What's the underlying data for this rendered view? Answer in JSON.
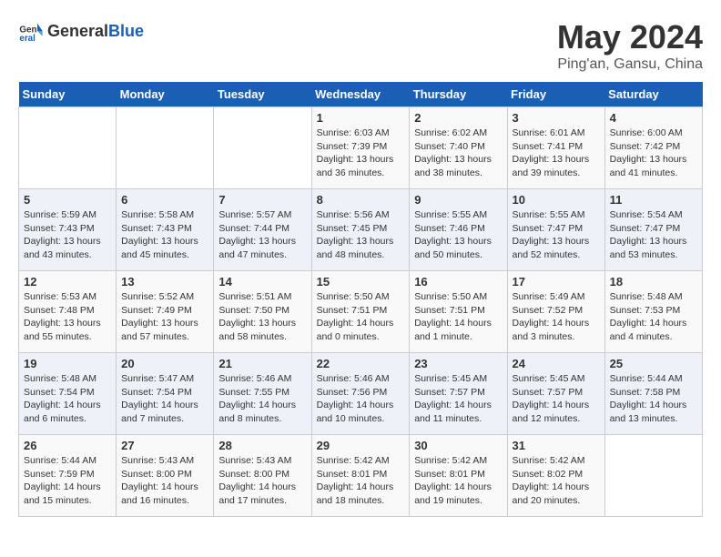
{
  "logo": {
    "text_general": "General",
    "text_blue": "Blue"
  },
  "title": "May 2024",
  "subtitle": "Ping'an, Gansu, China",
  "days_of_week": [
    "Sunday",
    "Monday",
    "Tuesday",
    "Wednesday",
    "Thursday",
    "Friday",
    "Saturday"
  ],
  "weeks": [
    [
      {
        "day": "",
        "info": ""
      },
      {
        "day": "",
        "info": ""
      },
      {
        "day": "",
        "info": ""
      },
      {
        "day": "1",
        "info": "Sunrise: 6:03 AM\nSunset: 7:39 PM\nDaylight: 13 hours\nand 36 minutes."
      },
      {
        "day": "2",
        "info": "Sunrise: 6:02 AM\nSunset: 7:40 PM\nDaylight: 13 hours\nand 38 minutes."
      },
      {
        "day": "3",
        "info": "Sunrise: 6:01 AM\nSunset: 7:41 PM\nDaylight: 13 hours\nand 39 minutes."
      },
      {
        "day": "4",
        "info": "Sunrise: 6:00 AM\nSunset: 7:42 PM\nDaylight: 13 hours\nand 41 minutes."
      }
    ],
    [
      {
        "day": "5",
        "info": "Sunrise: 5:59 AM\nSunset: 7:43 PM\nDaylight: 13 hours\nand 43 minutes."
      },
      {
        "day": "6",
        "info": "Sunrise: 5:58 AM\nSunset: 7:43 PM\nDaylight: 13 hours\nand 45 minutes."
      },
      {
        "day": "7",
        "info": "Sunrise: 5:57 AM\nSunset: 7:44 PM\nDaylight: 13 hours\nand 47 minutes."
      },
      {
        "day": "8",
        "info": "Sunrise: 5:56 AM\nSunset: 7:45 PM\nDaylight: 13 hours\nand 48 minutes."
      },
      {
        "day": "9",
        "info": "Sunrise: 5:55 AM\nSunset: 7:46 PM\nDaylight: 13 hours\nand 50 minutes."
      },
      {
        "day": "10",
        "info": "Sunrise: 5:55 AM\nSunset: 7:47 PM\nDaylight: 13 hours\nand 52 minutes."
      },
      {
        "day": "11",
        "info": "Sunrise: 5:54 AM\nSunset: 7:47 PM\nDaylight: 13 hours\nand 53 minutes."
      }
    ],
    [
      {
        "day": "12",
        "info": "Sunrise: 5:53 AM\nSunset: 7:48 PM\nDaylight: 13 hours\nand 55 minutes."
      },
      {
        "day": "13",
        "info": "Sunrise: 5:52 AM\nSunset: 7:49 PM\nDaylight: 13 hours\nand 57 minutes."
      },
      {
        "day": "14",
        "info": "Sunrise: 5:51 AM\nSunset: 7:50 PM\nDaylight: 13 hours\nand 58 minutes."
      },
      {
        "day": "15",
        "info": "Sunrise: 5:50 AM\nSunset: 7:51 PM\nDaylight: 14 hours\nand 0 minutes."
      },
      {
        "day": "16",
        "info": "Sunrise: 5:50 AM\nSunset: 7:51 PM\nDaylight: 14 hours\nand 1 minute."
      },
      {
        "day": "17",
        "info": "Sunrise: 5:49 AM\nSunset: 7:52 PM\nDaylight: 14 hours\nand 3 minutes."
      },
      {
        "day": "18",
        "info": "Sunrise: 5:48 AM\nSunset: 7:53 PM\nDaylight: 14 hours\nand 4 minutes."
      }
    ],
    [
      {
        "day": "19",
        "info": "Sunrise: 5:48 AM\nSunset: 7:54 PM\nDaylight: 14 hours\nand 6 minutes."
      },
      {
        "day": "20",
        "info": "Sunrise: 5:47 AM\nSunset: 7:54 PM\nDaylight: 14 hours\nand 7 minutes."
      },
      {
        "day": "21",
        "info": "Sunrise: 5:46 AM\nSunset: 7:55 PM\nDaylight: 14 hours\nand 8 minutes."
      },
      {
        "day": "22",
        "info": "Sunrise: 5:46 AM\nSunset: 7:56 PM\nDaylight: 14 hours\nand 10 minutes."
      },
      {
        "day": "23",
        "info": "Sunrise: 5:45 AM\nSunset: 7:57 PM\nDaylight: 14 hours\nand 11 minutes."
      },
      {
        "day": "24",
        "info": "Sunrise: 5:45 AM\nSunset: 7:57 PM\nDaylight: 14 hours\nand 12 minutes."
      },
      {
        "day": "25",
        "info": "Sunrise: 5:44 AM\nSunset: 7:58 PM\nDaylight: 14 hours\nand 13 minutes."
      }
    ],
    [
      {
        "day": "26",
        "info": "Sunrise: 5:44 AM\nSunset: 7:59 PM\nDaylight: 14 hours\nand 15 minutes."
      },
      {
        "day": "27",
        "info": "Sunrise: 5:43 AM\nSunset: 8:00 PM\nDaylight: 14 hours\nand 16 minutes."
      },
      {
        "day": "28",
        "info": "Sunrise: 5:43 AM\nSunset: 8:00 PM\nDaylight: 14 hours\nand 17 minutes."
      },
      {
        "day": "29",
        "info": "Sunrise: 5:42 AM\nSunset: 8:01 PM\nDaylight: 14 hours\nand 18 minutes."
      },
      {
        "day": "30",
        "info": "Sunrise: 5:42 AM\nSunset: 8:01 PM\nDaylight: 14 hours\nand 19 minutes."
      },
      {
        "day": "31",
        "info": "Sunrise: 5:42 AM\nSunset: 8:02 PM\nDaylight: 14 hours\nand 20 minutes."
      },
      {
        "day": "",
        "info": ""
      }
    ]
  ]
}
